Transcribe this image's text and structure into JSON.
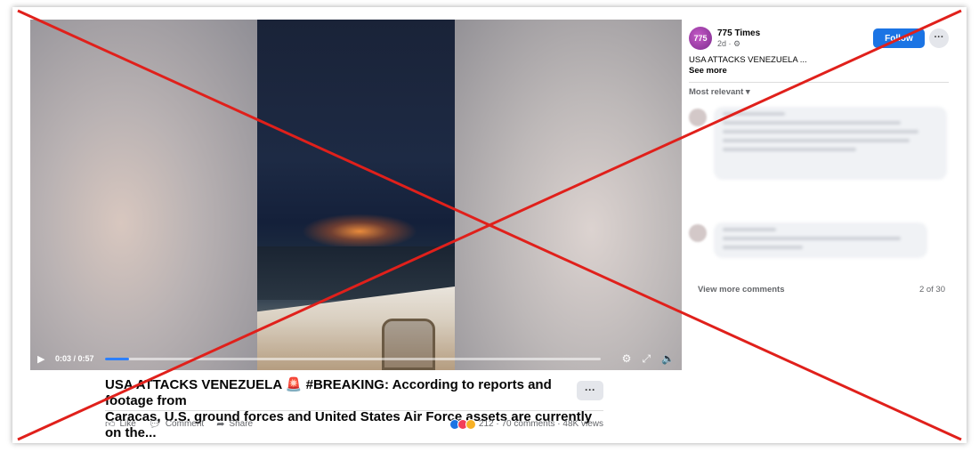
{
  "video": {
    "time": "0:03 / 0:57",
    "progress": 0.05,
    "icons": [
      "play-icon",
      "settings-icon",
      "fullscreen-icon",
      "volume-icon"
    ]
  },
  "post": {
    "caption_line1": "USA ATTACKS VENEZUELA 🚨 #BREAKING: According to reports and footage from",
    "caption_line2": "Caracas, U.S. ground forces and United States Air Force assets are currently on the...",
    "more": "···",
    "actions": {
      "like": "Like",
      "comment": "Comment",
      "share": "Share"
    },
    "reactions_count": "212",
    "stats": "· 70 comments · 48K views"
  },
  "sidebar": {
    "avatar_text": "775",
    "page_name": "775 Times",
    "meta": "2d · ⚙",
    "follow": "Follow",
    "more": "···",
    "post_text": "USA ATTACKS VENEZUELA ...",
    "see_more": "See more",
    "sort": "Most relevant ▾",
    "view_more": "View more comments",
    "count": "2 of 30"
  },
  "colors": {
    "accent": "#1b74e4",
    "cross": "#e0201b"
  }
}
